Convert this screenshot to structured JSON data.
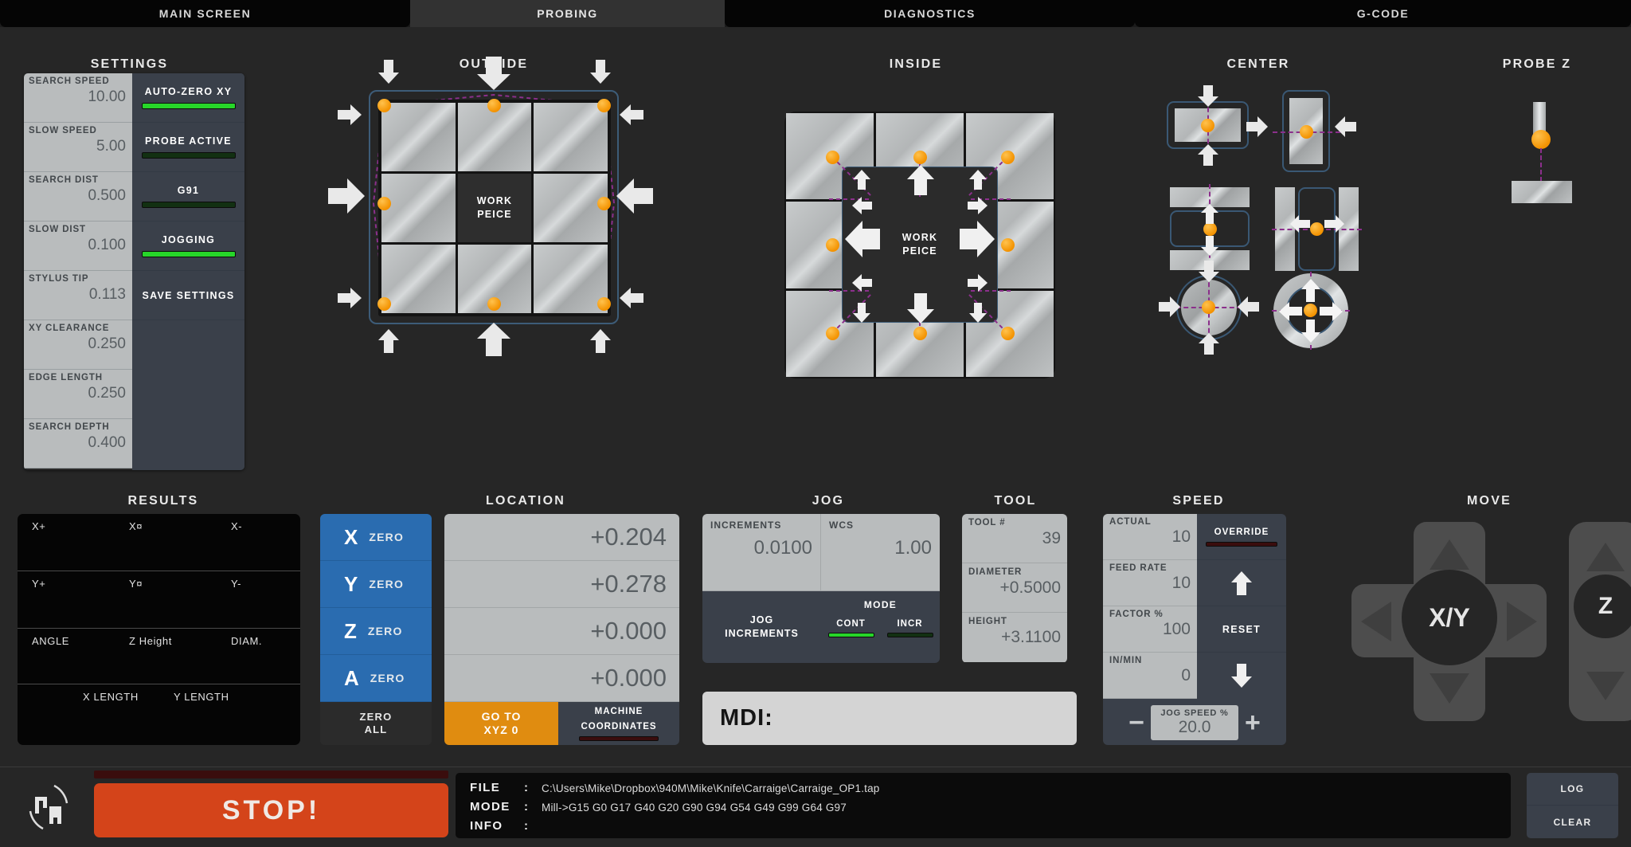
{
  "tabs": [
    {
      "label": "MAIN SCREEN",
      "active": false
    },
    {
      "label": "PROBING",
      "active": true
    },
    {
      "label": "DIAGNOSTICS",
      "active": false
    },
    {
      "label": "G-CODE",
      "active": false
    }
  ],
  "settings": {
    "title": "SETTINGS",
    "fields": [
      {
        "label": "SEARCH SPEED",
        "value": "10.00"
      },
      {
        "label": "SLOW SPEED",
        "value": "5.00"
      },
      {
        "label": "SEARCH DIST",
        "value": "0.500"
      },
      {
        "label": "SLOW DIST",
        "value": "0.100"
      },
      {
        "label": "STYLUS TIP",
        "value": "0.113"
      },
      {
        "label": "XY CLEARANCE",
        "value": "0.250"
      },
      {
        "label": "EDGE LENGTH",
        "value": "0.250"
      },
      {
        "label": "SEARCH DEPTH",
        "value": "0.400"
      }
    ],
    "buttons": [
      {
        "label": "AUTO-ZERO XY",
        "led": "on"
      },
      {
        "label": "PROBE ACTIVE",
        "led": "off"
      },
      {
        "label": "G91",
        "led": "off"
      },
      {
        "label": "JOGGING",
        "led": "on"
      },
      {
        "label": "SAVE SETTINGS",
        "led": "none"
      }
    ]
  },
  "diagrams": {
    "outside_title": "OUTSIDE",
    "inside_title": "INSIDE",
    "center_title": "CENTER",
    "probez_title": "PROBE Z",
    "workpiece_line1": "WORK",
    "workpiece_line2": "PEICE"
  },
  "results": {
    "title": "RESULTS",
    "rows": [
      [
        "X+",
        "X¤",
        "X-"
      ],
      [
        "Y+",
        "Y¤",
        "Y-"
      ],
      [
        "ANGLE",
        "Z Height",
        "DIAM."
      ]
    ],
    "lengths": [
      "X LENGTH",
      "Y LENGTH"
    ]
  },
  "location": {
    "title": "LOCATION",
    "axes": [
      {
        "axis": "X",
        "zero_label": "ZERO",
        "value": "+0.204"
      },
      {
        "axis": "Y",
        "zero_label": "ZERO",
        "value": "+0.278"
      },
      {
        "axis": "Z",
        "zero_label": "ZERO",
        "value": "+0.000"
      },
      {
        "axis": "A",
        "zero_label": "ZERO",
        "value": "+0.000"
      }
    ],
    "zero_all_line1": "ZERO",
    "zero_all_line2": "ALL",
    "goto_line1": "GO TO",
    "goto_line2": "XYZ 0",
    "machine_line1": "MACHINE",
    "machine_line2": "COORDINATES",
    "machine_led": "off"
  },
  "jog": {
    "title": "JOG",
    "increments_label": "INCREMENTS",
    "increments_value": "0.0100",
    "wcs_label": "WCS",
    "wcs_value": "1.00",
    "jog_increments_line1": "JOG",
    "jog_increments_line2": "INCREMENTS",
    "mode_label": "MODE",
    "mode_cont": "CONT",
    "mode_incr": "INCR",
    "mode_cont_led": "on",
    "mode_incr_led": "off",
    "mdi_label": "MDI:",
    "mdi_value": ""
  },
  "tool": {
    "title": "TOOL",
    "fields": [
      {
        "label": "TOOL #",
        "value": "39"
      },
      {
        "label": "DIAMETER",
        "value": "+0.5000"
      },
      {
        "label": "HEIGHT",
        "value": "+3.1100"
      }
    ]
  },
  "speed": {
    "title": "SPEED",
    "fields": [
      {
        "label": "ACTUAL",
        "value": "10"
      },
      {
        "label": "FEED RATE",
        "value": "10"
      },
      {
        "label": "FACTOR %",
        "value": "100"
      },
      {
        "label": "IN/MIN",
        "value": "0"
      }
    ],
    "override_label": "OVERRIDE",
    "override_led": "off",
    "reset_label": "RESET",
    "jog_speed_label": "JOG SPEED %",
    "jog_speed_value": "20.0",
    "minus_label": "−",
    "plus_label": "+"
  },
  "move": {
    "title": "MOVE",
    "xy_label": "X/Y",
    "z_label": "Z"
  },
  "bottom": {
    "stop_label": "STOP!",
    "stop_led": "off",
    "file_key": "FILE",
    "file_colon": ":",
    "file_value": "C:\\Users\\Mike\\Dropbox\\940M\\Mike\\Knife\\Carraige\\Carraige_OP1.tap",
    "mode_key": "MODE",
    "mode_colon": ":",
    "mode_value": "Mill->G15  G0 G17 G40 G20 G90 G94 G54 G49 G99 G64 G97",
    "info_key": "INFO",
    "info_colon": ":",
    "info_value": "",
    "log_label": "LOG",
    "clear_label": "CLEAR"
  },
  "colors": {
    "accent_orange": "#f39200",
    "accent_blue": "#2a6cb0",
    "goto_orange": "#e08c10",
    "stop_red": "#d4441a",
    "led_green": "#27d629",
    "panel": "#3a404a",
    "field": "#b9bcbd"
  }
}
